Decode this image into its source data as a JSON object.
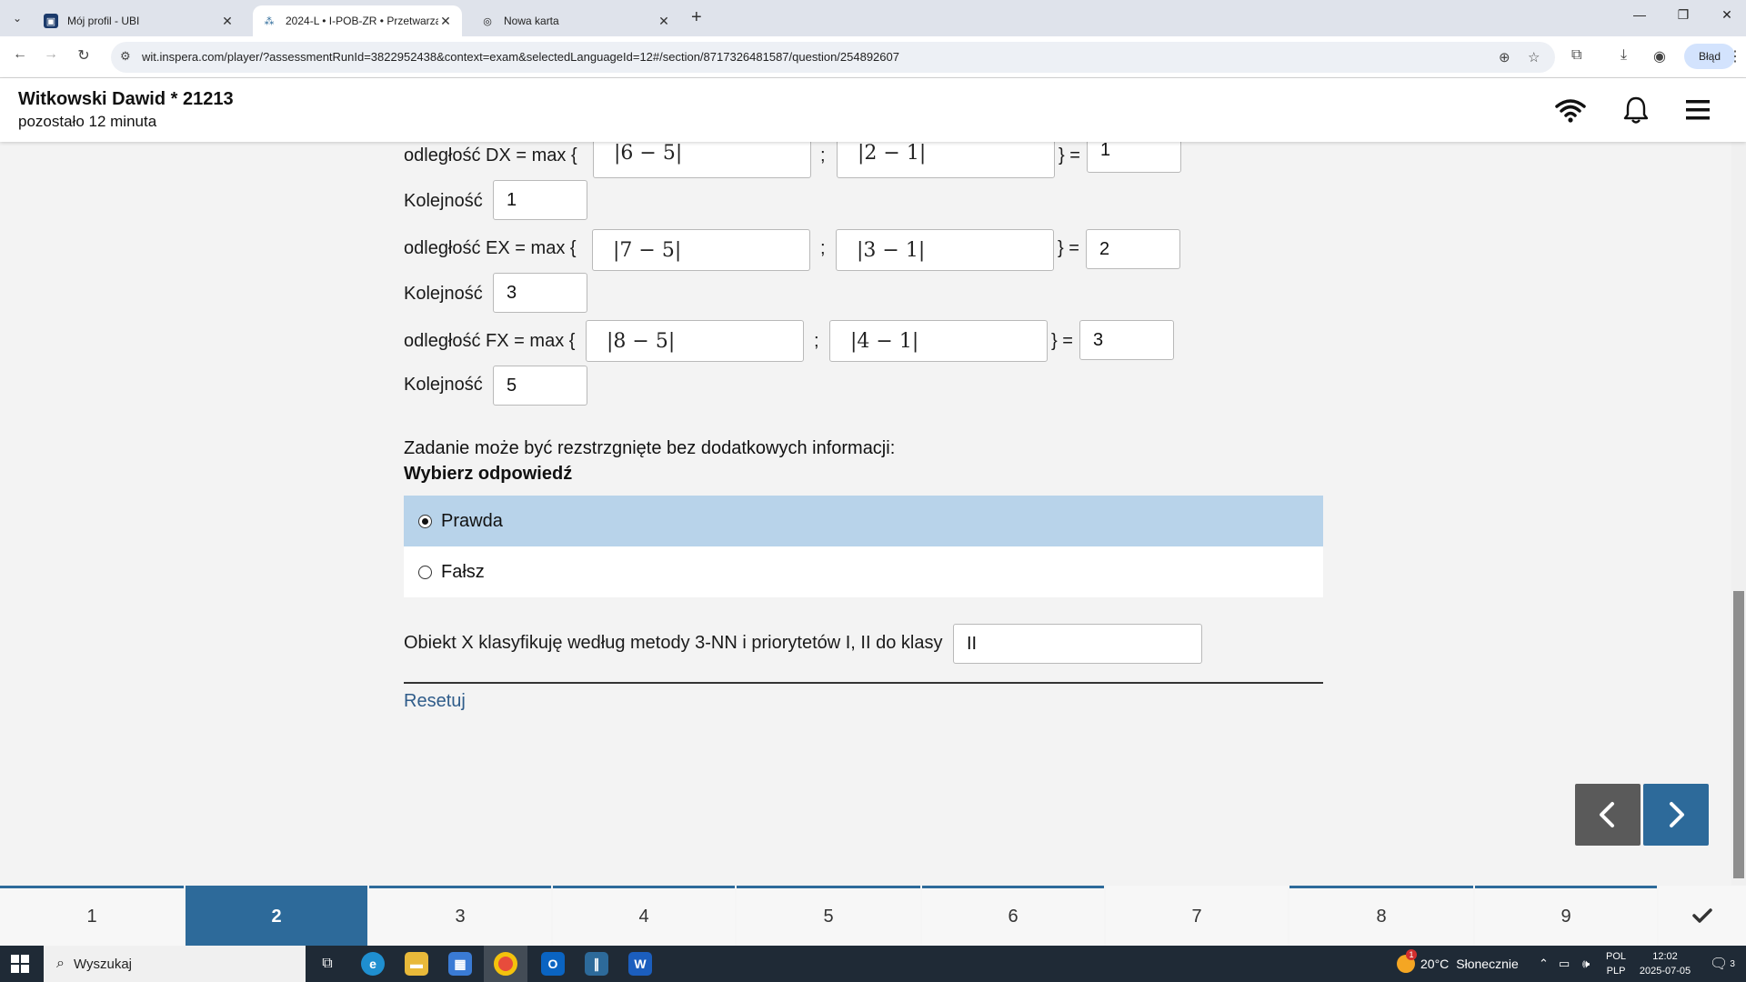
{
  "browser": {
    "tabs": [
      {
        "label": "Mój profil - UBI",
        "close": "✕"
      },
      {
        "label": "2024-L • I-POB-ZR • Przetwarzanie",
        "close": "✕"
      },
      {
        "label": "Nowa karta",
        "close": "✕"
      }
    ],
    "new_tab": "+",
    "url": "wit.inspera.com/player/?assessmentRunId=3822952438&context=exam&selectedLanguageId=12#/section/8717326481587/question/254892607",
    "profile_error_label": "Błąd"
  },
  "header": {
    "student": "Witkowski Dawid * 21213",
    "remaining": "pozostało 12 minuta"
  },
  "rows": [
    {
      "label": "odległość DX =  max {",
      "a": "|6 − 5|",
      "sep": ";",
      "b": "|2 − 1|",
      "eq": "} =",
      "result": "1",
      "order_label": "Kolejność",
      "order": "1"
    },
    {
      "label": "odległość EX =  max {",
      "a": "|7 − 5|",
      "sep": ";",
      "b": "|3 − 1|",
      "eq": "} =",
      "result": "2",
      "order_label": "Kolejność",
      "order": "3"
    },
    {
      "label": "odległość FX =  max {",
      "a": "|8 − 5|",
      "sep": ";",
      "b": "|4 − 1|",
      "eq": "} =",
      "result": "3",
      "order_label": "Kolejność",
      "order": "5"
    }
  ],
  "question": {
    "text": "Zadanie może być rezstrzgnięte bez dodatkowych informacji:",
    "choose": "Wybierz odpowiedź",
    "options": [
      {
        "label": "Prawda",
        "selected": true
      },
      {
        "label": "Fałsz",
        "selected": false
      }
    ]
  },
  "classify": {
    "text": "Obiekt X klasyfikuję według metody 3-NN i priorytetów  I, II do klasy",
    "value": "II"
  },
  "reset_label": "Resetuj",
  "question_nav": {
    "items": [
      "1",
      "2",
      "3",
      "4",
      "5",
      "6",
      "7",
      "8",
      "9"
    ],
    "current": "2",
    "answered": [
      "1",
      "2",
      "3",
      "4",
      "5",
      "6",
      "8",
      "9"
    ]
  },
  "taskbar": {
    "search_label": "Wyszukaj",
    "weather_temp": "20°C",
    "weather_desc": "Słonecznie",
    "lang_top": "POL",
    "lang_bottom": "PLP",
    "time": "12:02",
    "date": "2025-07-05",
    "notification_count": "3",
    "weather_badge": "1"
  },
  "colors": {
    "accent": "#2d6a9a",
    "selected_option": "#b8d3ea",
    "prev_button": "#5a5a5a",
    "taskbar": "#1f2a36"
  }
}
